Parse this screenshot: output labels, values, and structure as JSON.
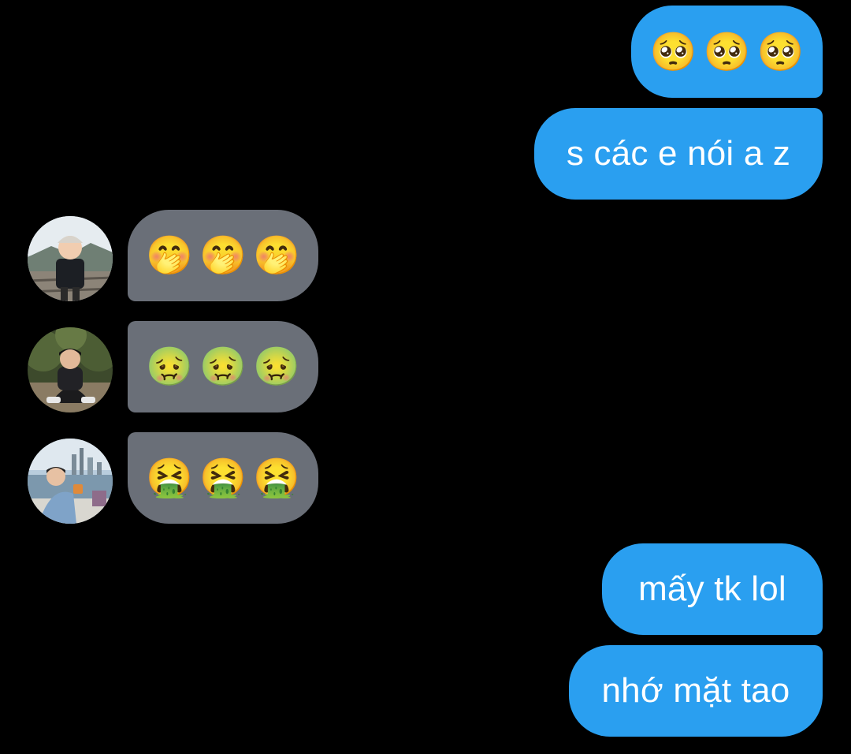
{
  "messages": [
    {
      "id": "m1",
      "side": "out",
      "kind": "emoji",
      "emojis": [
        "🥺",
        "🥺",
        "🥺"
      ],
      "emoji_name": "pleading-face-emoji"
    },
    {
      "id": "m2",
      "side": "out",
      "kind": "text",
      "text": "s các e nói a z"
    },
    {
      "id": "m3",
      "side": "in",
      "kind": "emoji",
      "emojis": [
        "🤭",
        "🤭",
        "🤭"
      ],
      "emoji_name": "hand-over-mouth-emoji",
      "avatar": "avatar-boy-cap"
    },
    {
      "id": "m4",
      "side": "in",
      "kind": "emoji",
      "emojis": [
        "🤢",
        "🤢",
        "🤢"
      ],
      "emoji_name": "nauseated-face-emoji",
      "avatar": "avatar-boy-garden"
    },
    {
      "id": "m5",
      "side": "in",
      "kind": "emoji",
      "emojis": [
        "🤮",
        "🤮",
        "🤮"
      ],
      "emoji_name": "vomiting-face-emoji",
      "avatar": "avatar-boy-seaside"
    },
    {
      "id": "m6",
      "side": "out",
      "kind": "text",
      "text": "mấy tk lol"
    },
    {
      "id": "m7",
      "side": "out",
      "kind": "text",
      "text": "nhớ mặt tao"
    }
  ],
  "colors": {
    "background": "#000000",
    "outgoing_bubble": "#2a9ff0",
    "incoming_bubble": "#6a6f78",
    "text": "#ffffff"
  }
}
